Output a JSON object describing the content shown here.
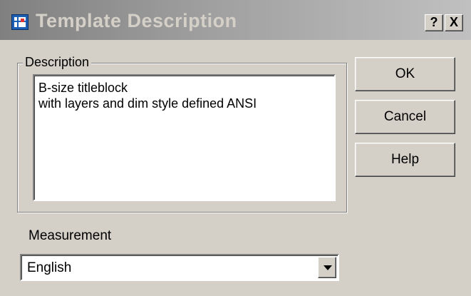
{
  "window": {
    "title": "Template Description",
    "icon": "app-icon",
    "help_caption": "?",
    "close_caption": "X"
  },
  "description_group": {
    "label": "Description",
    "lines": [
      "B-size titleblock",
      "with layers and dim style defined ANSI"
    ]
  },
  "buttons": {
    "ok": "OK",
    "cancel": "Cancel",
    "help": "Help"
  },
  "measurement": {
    "label": "Measurement",
    "selected": "English",
    "dropdown_icon": "chevron-down-icon"
  },
  "colors": {
    "dialog_face": "#d4d0c8",
    "titlebar_inactive_start": "#808080",
    "titlebar_inactive_end": "#c0c0c0"
  }
}
